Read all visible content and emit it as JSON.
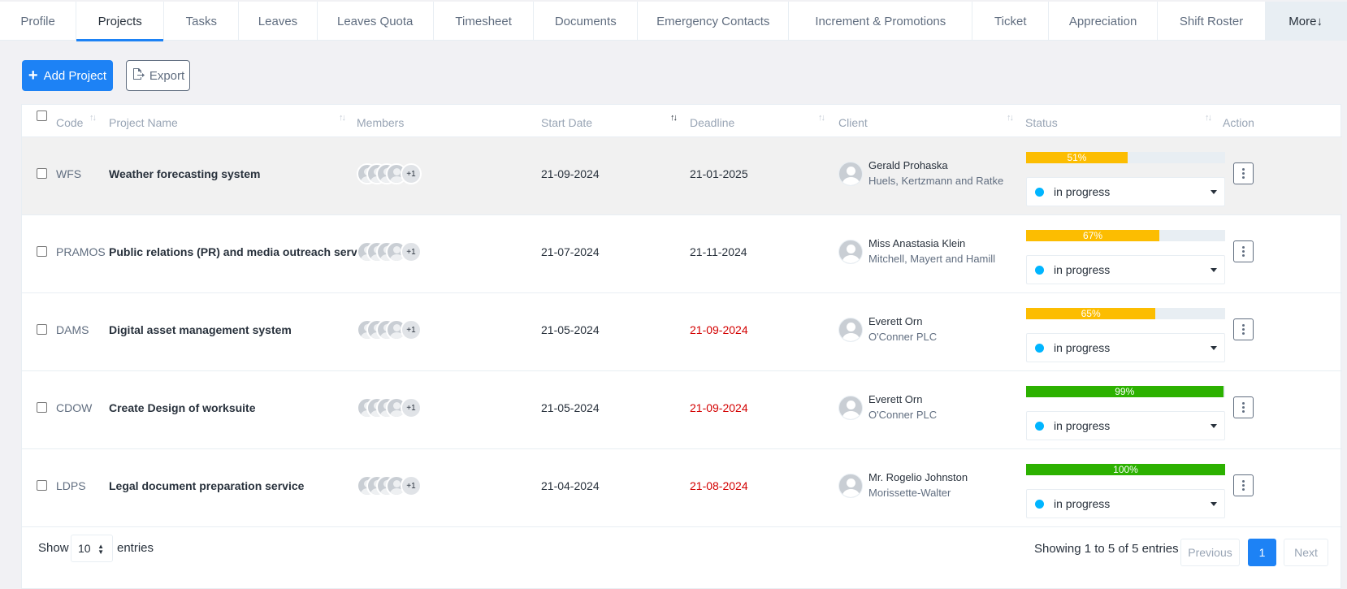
{
  "tabs": [
    "Profile",
    "Projects",
    "Tasks",
    "Leaves",
    "Leaves Quota",
    "Timesheet",
    "Documents",
    "Emergency Contacts",
    "Increment & Promotions",
    "Ticket",
    "Appreciation",
    "Shift Roster",
    "More↓"
  ],
  "active_tab": "Projects",
  "toolbar": {
    "add_label": "Add Project",
    "add_icon": "plus-icon",
    "export_label": "Export",
    "export_icon": "file-export-icon"
  },
  "table": {
    "headers": {
      "code": "Code",
      "name": "Project Name",
      "members": "Members",
      "start": "Start Date",
      "deadline": "Deadline",
      "client": "Client",
      "status": "Status",
      "action": "Action"
    },
    "rows": [
      {
        "code": "WFS",
        "name": "Weather forecasting system",
        "members_extra": "+1",
        "start": "21-09-2024",
        "deadline": "21-01-2025",
        "deadline_overdue": false,
        "client_name": "Gerald Prohaska",
        "client_company": "Huels, Kertzmann and Ratke",
        "progress": 51,
        "progress_label": "51%",
        "status": "in progress"
      },
      {
        "code": "PRAMOS",
        "name": "Public relations (PR) and media outreach service",
        "members_extra": "+1",
        "start": "21-07-2024",
        "deadline": "21-11-2024",
        "deadline_overdue": false,
        "client_name": "Miss Anastasia Klein",
        "client_company": "Mitchell, Mayert and Hamill",
        "progress": 67,
        "progress_label": "67%",
        "status": "in progress"
      },
      {
        "code": "DAMS",
        "name": "Digital asset management system",
        "members_extra": "+1",
        "start": "21-05-2024",
        "deadline": "21-09-2024",
        "deadline_overdue": true,
        "client_name": "Everett Orn",
        "client_company": "O'Conner PLC",
        "progress": 65,
        "progress_label": "65%",
        "status": "in progress"
      },
      {
        "code": "CDOW",
        "name": "Create Design of worksuite",
        "members_extra": "+1",
        "start": "21-05-2024",
        "deadline": "21-09-2024",
        "deadline_overdue": true,
        "client_name": "Everett Orn",
        "client_company": "O'Conner PLC",
        "progress": 99,
        "progress_label": "99%",
        "status": "in progress"
      },
      {
        "code": "LDPS",
        "name": "Legal document preparation service",
        "members_extra": "+1",
        "start": "21-04-2024",
        "deadline": "21-08-2024",
        "deadline_overdue": true,
        "client_name": "Mr. Rogelio Johnston",
        "client_company": "Morissette-Walter",
        "progress": 100,
        "progress_label": "100%",
        "status": "in progress"
      }
    ]
  },
  "colors": {
    "primary": "#1d82f5",
    "overdue": "#d30000",
    "progress_mid": "#fcbd01",
    "progress_high": "#2cb100",
    "status_dot": "#00b5ff"
  },
  "footer": {
    "show_label": "Show",
    "length_value": "10",
    "entries_label": "entries",
    "info": "Showing 1 to 5 of 5 entries",
    "prev_label": "Previous",
    "page": "1",
    "next_label": "Next"
  }
}
